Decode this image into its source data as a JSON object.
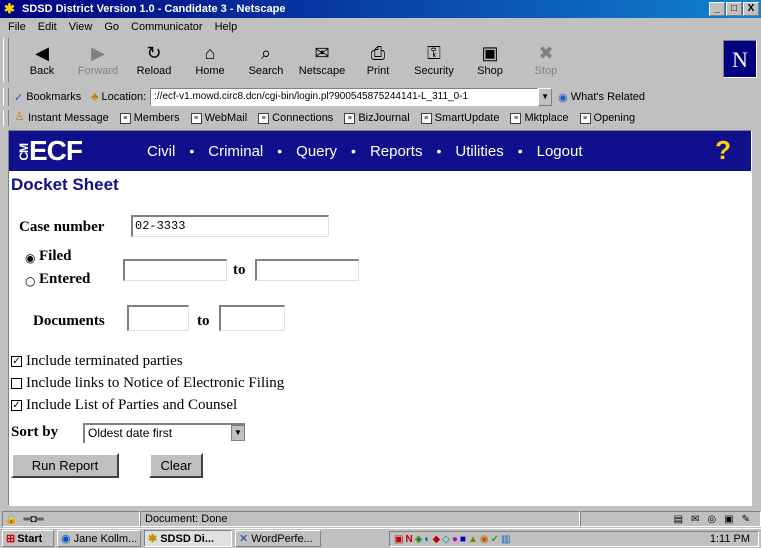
{
  "window": {
    "title": "SDSD District Version 1.0 - Candidate 3 - Netscape",
    "controls": [
      "_",
      "□",
      "X"
    ]
  },
  "menu": [
    "File",
    "Edit",
    "View",
    "Go",
    "Communicator",
    "Help"
  ],
  "toolbar": [
    {
      "label": "Back",
      "icon": "back-arrow-icon",
      "glyph": "◀",
      "enabled": true
    },
    {
      "label": "Forward",
      "icon": "forward-arrow-icon",
      "glyph": "▶",
      "enabled": false
    },
    {
      "label": "Reload",
      "icon": "reload-icon",
      "glyph": "↻",
      "enabled": true
    },
    {
      "label": "Home",
      "icon": "home-icon",
      "glyph": "⌂",
      "enabled": true
    },
    {
      "label": "Search",
      "icon": "search-icon",
      "glyph": "⌕",
      "enabled": true
    },
    {
      "label": "Netscape",
      "icon": "netscape-icon",
      "glyph": "✉",
      "enabled": true
    },
    {
      "label": "Print",
      "icon": "print-icon",
      "glyph": "⎙",
      "enabled": true
    },
    {
      "label": "Security",
      "icon": "lock-icon",
      "glyph": "⚿",
      "enabled": true
    },
    {
      "label": "Shop",
      "icon": "shop-icon",
      "glyph": "▣",
      "enabled": true
    },
    {
      "label": "Stop",
      "icon": "stop-icon",
      "glyph": "✖",
      "enabled": false
    }
  ],
  "location": {
    "bookmarks_label": "Bookmarks",
    "location_label": "Location:",
    "url": "://ecf-v1.mowd.circ8.dcn/cgi-bin/login.pl?900545875244141-L_311_0-1",
    "whats_related": "What's Related"
  },
  "personal_toolbar": [
    "Instant Message",
    "Members",
    "WebMail",
    "Connections",
    "BizJournal",
    "SmartUpdate",
    "Mktplace",
    "Opening"
  ],
  "ecf": {
    "logo": "ECF",
    "logo_prefix": "CM",
    "nav": [
      "Civil",
      "Criminal",
      "Query",
      "Reports",
      "Utilities",
      "Logout"
    ],
    "separator": "•"
  },
  "page": {
    "title": "Docket Sheet",
    "case_number_label": "Case number",
    "case_number_value": "02-3333",
    "filed_label": "Filed",
    "entered_label": "Entered",
    "date_from": "",
    "to_label": "to",
    "date_to": "",
    "documents_label": "Documents",
    "doc_from": "",
    "doc_to": "",
    "checkboxes": [
      {
        "label": "Include terminated parties",
        "checked": true
      },
      {
        "label": "Include links to Notice of Electronic Filing",
        "checked": false
      },
      {
        "label": "Include List of Parties and Counsel",
        "checked": true
      }
    ],
    "sort_label": "Sort by",
    "sort_value": "Oldest date first",
    "run_button": "Run Report",
    "clear_button": "Clear"
  },
  "status": {
    "text": "Document: Done"
  },
  "taskbar": {
    "start": "Start",
    "tasks": [
      {
        "label": "Jane Kollm...",
        "active": false
      },
      {
        "label": "SDSD Di...",
        "active": true
      },
      {
        "label": "WordPerfe...",
        "active": false
      }
    ],
    "clock": "1:11 PM"
  }
}
